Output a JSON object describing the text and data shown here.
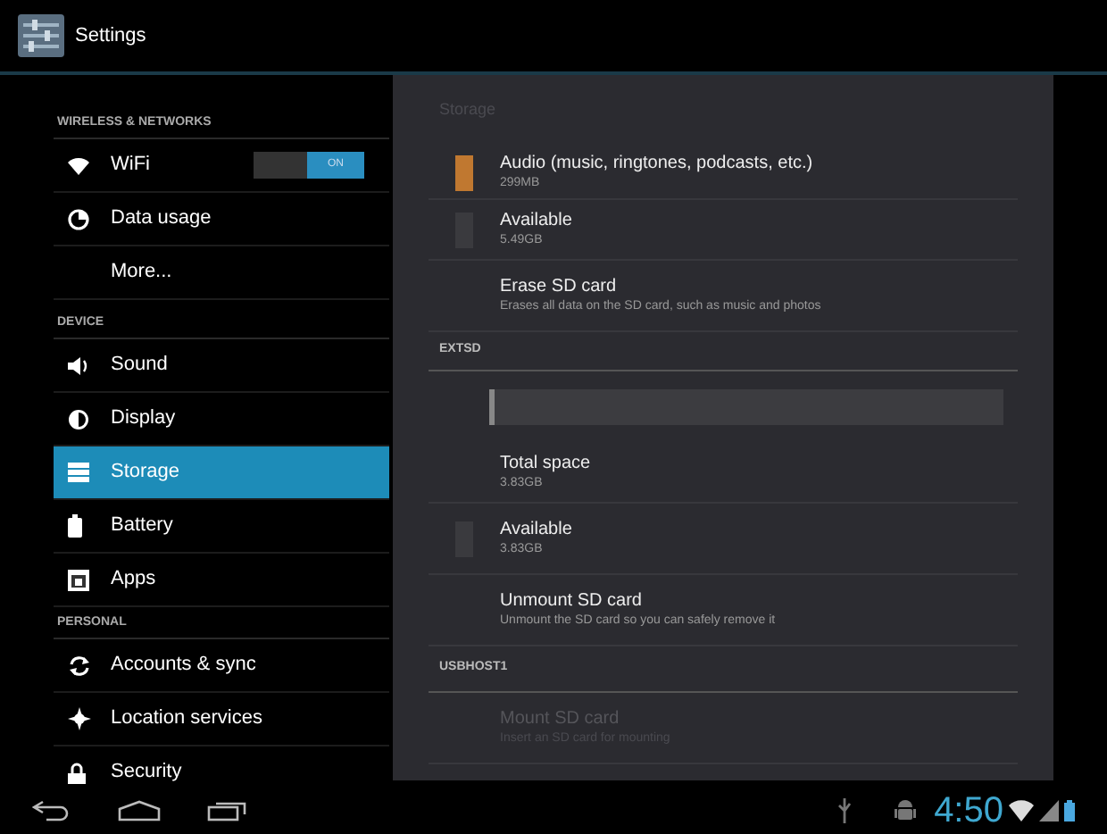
{
  "app_bar": {
    "title": "Settings"
  },
  "sidebar": {
    "items": [
      {
        "kind": "header",
        "label": "WIRELESS & NETWORKS"
      },
      {
        "kind": "item",
        "label": "WiFi",
        "selected": false,
        "toggle": {
          "label": "ON",
          "on": true
        }
      },
      {
        "kind": "item",
        "label": "Data usage",
        "selected": false
      },
      {
        "kind": "item",
        "label": "More...",
        "selected": false
      },
      {
        "kind": "header",
        "label": "DEVICE"
      },
      {
        "kind": "item",
        "label": "Sound",
        "selected": false
      },
      {
        "kind": "item",
        "label": "Display",
        "selected": false
      },
      {
        "kind": "item",
        "label": "Storage",
        "selected": true
      },
      {
        "kind": "item",
        "label": "Battery",
        "selected": false
      },
      {
        "kind": "item",
        "label": "Apps",
        "selected": false
      },
      {
        "kind": "header",
        "label": "PERSONAL"
      },
      {
        "kind": "item",
        "label": "Accounts & sync",
        "selected": false
      },
      {
        "kind": "item",
        "label": "Location services",
        "selected": false
      },
      {
        "kind": "item",
        "label": "Security",
        "selected": false
      }
    ]
  },
  "detail": {
    "title": "Storage",
    "rows": [
      {
        "kind": "item",
        "title": "Audio (music, ringtones, podcasts, etc.)",
        "summary": "299MB",
        "color": "#c07830",
        "disabled": false
      },
      {
        "kind": "item",
        "title": "Available",
        "summary": "5.49GB",
        "color": "#3a3a3e",
        "disabled": false
      },
      {
        "kind": "item",
        "title": "Erase SD card",
        "summary": "Erases all data on the SD card, such as music and photos",
        "disabled": false
      },
      {
        "kind": "header",
        "title": "EXTSD"
      },
      {
        "kind": "bar",
        "level": 0.01
      },
      {
        "kind": "item",
        "title": "Total space",
        "summary": "3.83GB",
        "disabled": false
      },
      {
        "kind": "item",
        "title": "Available",
        "summary": "3.83GB",
        "color": "#3a3a3e",
        "disabled": false
      },
      {
        "kind": "item",
        "title": "Unmount SD card",
        "summary": "Unmount the SD card so you can safely remove it",
        "disabled": false
      },
      {
        "kind": "header",
        "title": "USBHOST1"
      },
      {
        "kind": "item",
        "title": "Mount SD card",
        "summary": "Insert an SD card for mounting",
        "disabled": true
      }
    ]
  },
  "status_bar": {
    "time": "4:50"
  }
}
